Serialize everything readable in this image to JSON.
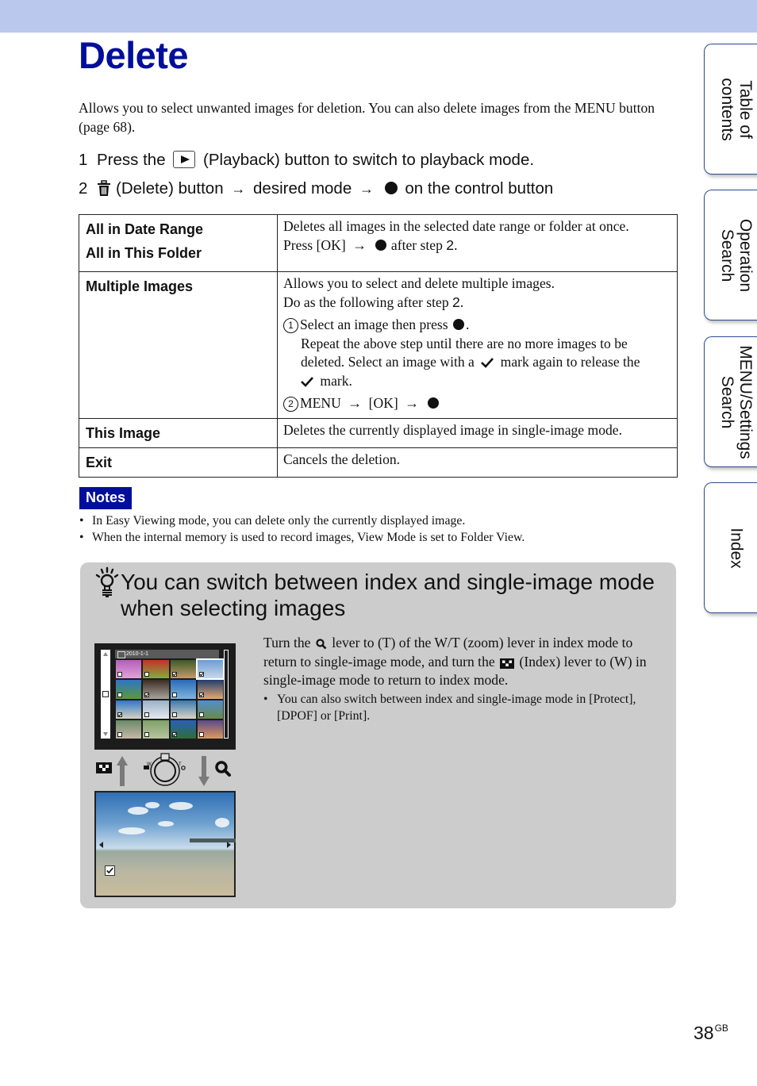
{
  "page": {
    "title": "Delete",
    "intro": "Allows you to select unwanted images for deletion. You can also delete images from the MENU button (page 68).",
    "page_number": "38",
    "page_suffix": "GB"
  },
  "steps": [
    {
      "num": "1",
      "pre": "Press the",
      "icon": "playback-icon",
      "post": "(Playback) button to switch to playback mode."
    },
    {
      "num": "2",
      "icon": "trash-icon",
      "part1": "(Delete) button",
      "part2": "desired mode",
      "part3": "on the control button"
    }
  ],
  "arrow": "→",
  "table": {
    "rows": [
      {
        "keys": [
          "All in Date Range",
          "All in This Folder"
        ],
        "line1": "Deletes all images in the selected date range or folder at once.",
        "line2_pre": "Press [OK]",
        "line2_post": "after step",
        "line2_step": "2",
        "line2_end": "."
      },
      {
        "keys": [
          "Multiple Images"
        ],
        "line1": "Allows you to select and delete multiple images.",
        "line2_pre": "Do as the following after step",
        "line2_step": "2",
        "line2_end": ".",
        "sub1_num": "1",
        "sub1_text": "Select an image then press",
        "sub1_line2": "Repeat the above step until there are no more images to be",
        "sub1_line3_pre": "deleted. Select an image with a",
        "sub1_line3_post": "mark again to release the",
        "sub1_line4": "mark.",
        "sub2_num": "2",
        "sub2_menu": "MENU",
        "sub2_ok": "[OK]"
      },
      {
        "keys": [
          "This Image"
        ],
        "line1": "Deletes the currently displayed image in single-image mode."
      },
      {
        "keys": [
          "Exit"
        ],
        "line1": "Cancels the deletion."
      }
    ]
  },
  "notes": {
    "label": "Notes",
    "items": [
      "In Easy Viewing mode, you can delete only the currently displayed image.",
      "When the internal memory is used to record images, View Mode is set to Folder View."
    ]
  },
  "tip": {
    "icon": "lightbulb-hint-icon",
    "title": "You can switch between index and single-image mode when selecting images",
    "text_p1": "Turn the",
    "text_p2": "lever to (T) of the W/T (zoom) lever in index mode to return to single-image mode, and turn the",
    "text_p3": "(Index) lever to (W) in single-image mode to return to index mode.",
    "bullet": "You can also switch between index and single-image mode in [Protect], [DPOF] or [Print].",
    "illustration": {
      "index_date": "2010-1-1",
      "lever_w": "W",
      "lever_t": "T",
      "thumbnails_checked": [
        false,
        false,
        true,
        true,
        false,
        true,
        false,
        true,
        true,
        false,
        false,
        false,
        false,
        false,
        true,
        false
      ],
      "selected_thumbnail": 4
    }
  },
  "side_tabs": [
    {
      "label": "Table of\ncontents"
    },
    {
      "label": "Operation\nSearch"
    },
    {
      "label": "MENU/Settings\nSearch"
    },
    {
      "label": "Index"
    }
  ],
  "colors": {
    "band": "#b9c8ec",
    "title": "#000f99",
    "notes_badge": "#000f99",
    "tip_box": "#cccccc",
    "tab_border": "#2c4b8c"
  }
}
